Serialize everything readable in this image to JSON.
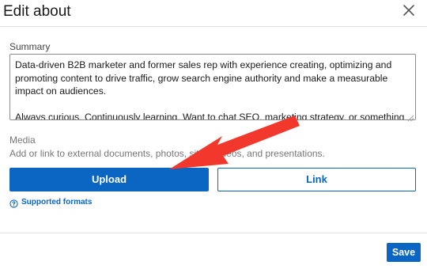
{
  "dialog": {
    "title": "Edit about",
    "close_icon": "close-icon"
  },
  "summary": {
    "label": "Summary",
    "value": "Data-driven B2B marketer and former sales rep with experience creating, optimizing and promoting content to drive traffic, grow search engine authority and make a measurable impact on audiences.\n\nAlways curious. Continuously learning. Want to chat SEO, marketing strategy, or something completely unrelated? Let's connect!"
  },
  "media": {
    "label": "Media",
    "description": "Add or link to external documents, photos, sites, videos, and presentations.",
    "upload_label": "Upload",
    "link_label": "Link",
    "supported_formats_label": "Supported formats",
    "help_icon": "question-circle-icon"
  },
  "footer": {
    "save_label": "Save"
  },
  "annotation": {
    "arrow_color": "#f2382c",
    "arrow_icon": "red-arrow-pointing-to-upload"
  },
  "colors": {
    "accent": "#0a66c2",
    "border": "#8c8c8c"
  }
}
